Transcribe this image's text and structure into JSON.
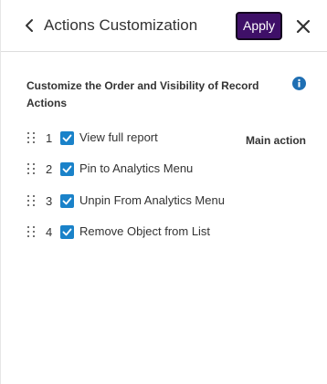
{
  "header": {
    "title": "Actions Customization",
    "apply_label": "Apply"
  },
  "section": {
    "title": "Customize the Order and Visibility of Record Actions"
  },
  "actions": [
    {
      "number": "1",
      "label": "View full report",
      "checked": true,
      "badge": "Main action"
    },
    {
      "number": "2",
      "label": "Pin to Analytics Menu",
      "checked": true
    },
    {
      "number": "3",
      "label": "Unpin From Analytics Menu",
      "checked": true
    },
    {
      "number": "4",
      "label": "Remove Object from List",
      "checked": true
    }
  ],
  "colors": {
    "accent": "#3f1068",
    "checkbox": "#1a82c9",
    "info_icon": "#1f6fb3"
  },
  "icons": {
    "back": "chevron-left-icon",
    "close": "close-icon",
    "info": "info-icon",
    "drag": "drag-handle-icon",
    "check": "checkmark-icon"
  }
}
